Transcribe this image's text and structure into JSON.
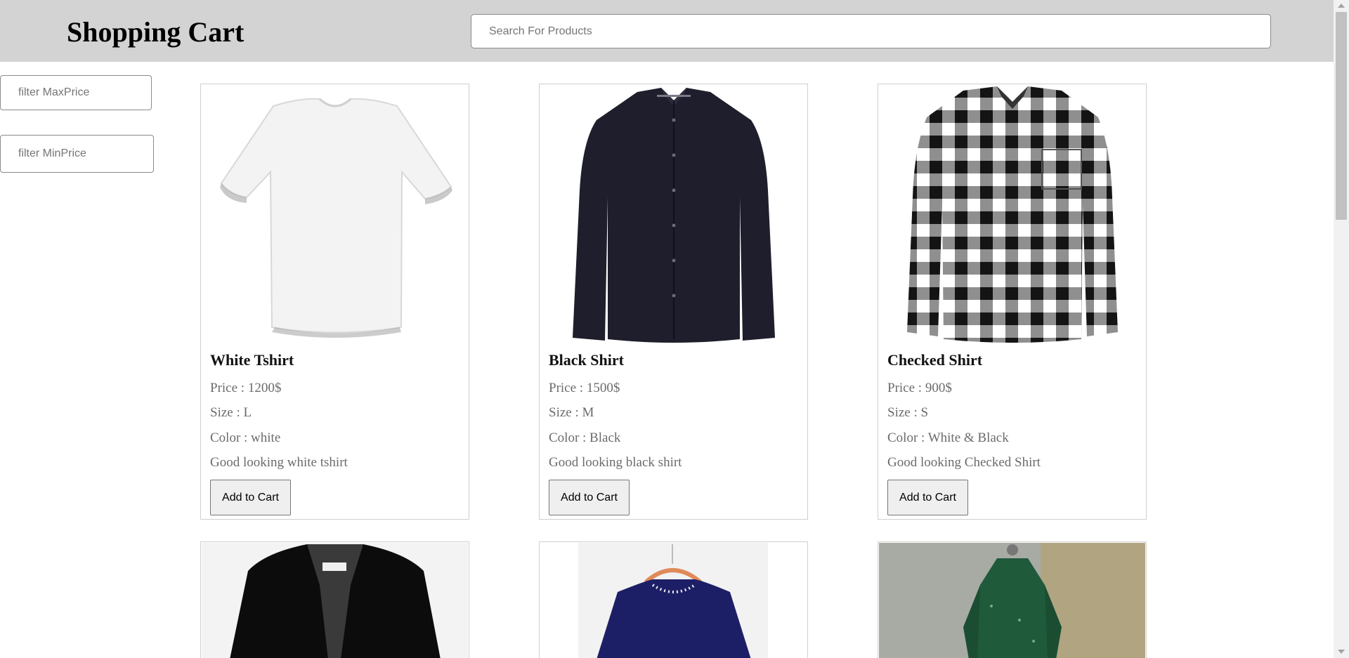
{
  "header": {
    "title": "Shopping Cart",
    "search_placeholder": "Search For Products"
  },
  "filters": {
    "max_price_placeholder": "filter MaxPrice",
    "min_price_placeholder": "filter MinPrice"
  },
  "products": [
    {
      "name": "White Tshirt",
      "price": "Price : 1200$",
      "size": "Size : L",
      "color": "Color : white",
      "description": "Good looking white tshirt",
      "button": "Add to Cart"
    },
    {
      "name": "Black Shirt",
      "price": "Price : 1500$",
      "size": "Size : M",
      "color": "Color : Black",
      "description": "Good looking black shirt",
      "button": "Add to Cart"
    },
    {
      "name": "Checked Shirt",
      "price": "Price : 900$",
      "size": "Size : S",
      "color": "Color : White & Black",
      "description": "Good looking Checked Shirt",
      "button": "Add to Cart"
    },
    {
      "image": "black-blazer-image"
    },
    {
      "image": "navy-blouse-image"
    },
    {
      "image": "green-dress-image"
    }
  ],
  "colors": {
    "header_bg": "#d3d3d3",
    "button_bg": "#efefef",
    "detail_text": "#6b6b6b"
  }
}
